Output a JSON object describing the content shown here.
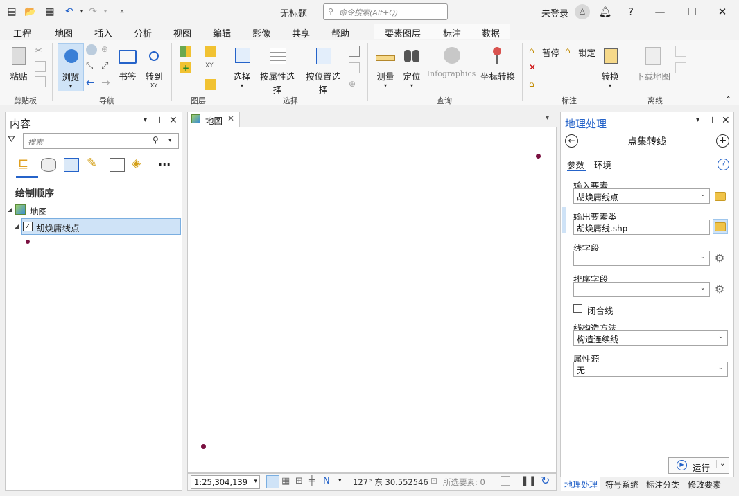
{
  "title": "无标题",
  "search": {
    "placeholder": "命令搜索(Alt+Q)"
  },
  "user": "未登录",
  "tabs": [
    "工程",
    "地图",
    "插入",
    "分析",
    "视图",
    "编辑",
    "影像",
    "共享",
    "帮助"
  ],
  "context_tabs": [
    "要素图层",
    "标注",
    "数据"
  ],
  "ribbon": {
    "clipboard": {
      "paste": "粘贴",
      "label": "剪贴板"
    },
    "nav": {
      "explore": "浏览",
      "bookmark": "书签",
      "goto": "转到",
      "goto_sub": "XY",
      "label": "导航"
    },
    "layer": {
      "label": "图层"
    },
    "selection": {
      "select": "选择",
      "by_attr": "按属性选择",
      "by_loc": "按位置选择",
      "label": "选择"
    },
    "inquiry": {
      "measure": "测量",
      "locate": "定位",
      "infographics": "Infographics",
      "convert": "坐标转换",
      "label": "查询"
    },
    "labeling": {
      "pause": "暂停",
      "lock": "锁定",
      "convert": "转换",
      "label": "标注"
    },
    "offline": {
      "download": "下载地图",
      "label": "离线"
    }
  },
  "contents": {
    "title": "内容",
    "search_placeholder": "搜索",
    "draw_order": "绘制顺序",
    "map": "地图",
    "layer": "胡焕庸线点"
  },
  "map_tab": "地图",
  "status": {
    "scale": "1:25,304,139",
    "coords": "127° 东 30.552546",
    "selected": "所选要素: 0"
  },
  "gp": {
    "title": "地理处理",
    "tool": "点集转线",
    "tab_params": "参数",
    "tab_env": "环境",
    "input_label": "输入要素",
    "input_value": "胡焕庸线点",
    "output_label": "输出要素类",
    "output_value": "胡焕庸线.shp",
    "line_field_label": "线字段",
    "sort_field_label": "排序字段",
    "close_line": "闭合线",
    "method_label": "线构造方法",
    "method_value": "构造连续线",
    "attr_label": "属性源",
    "attr_value": "无",
    "run": "运行"
  },
  "bottom_tabs": [
    "地理处理",
    "符号系统",
    "标注分类",
    "修改要素"
  ],
  "colors": {
    "accent": "#2563c9",
    "point": "#7a1040"
  }
}
